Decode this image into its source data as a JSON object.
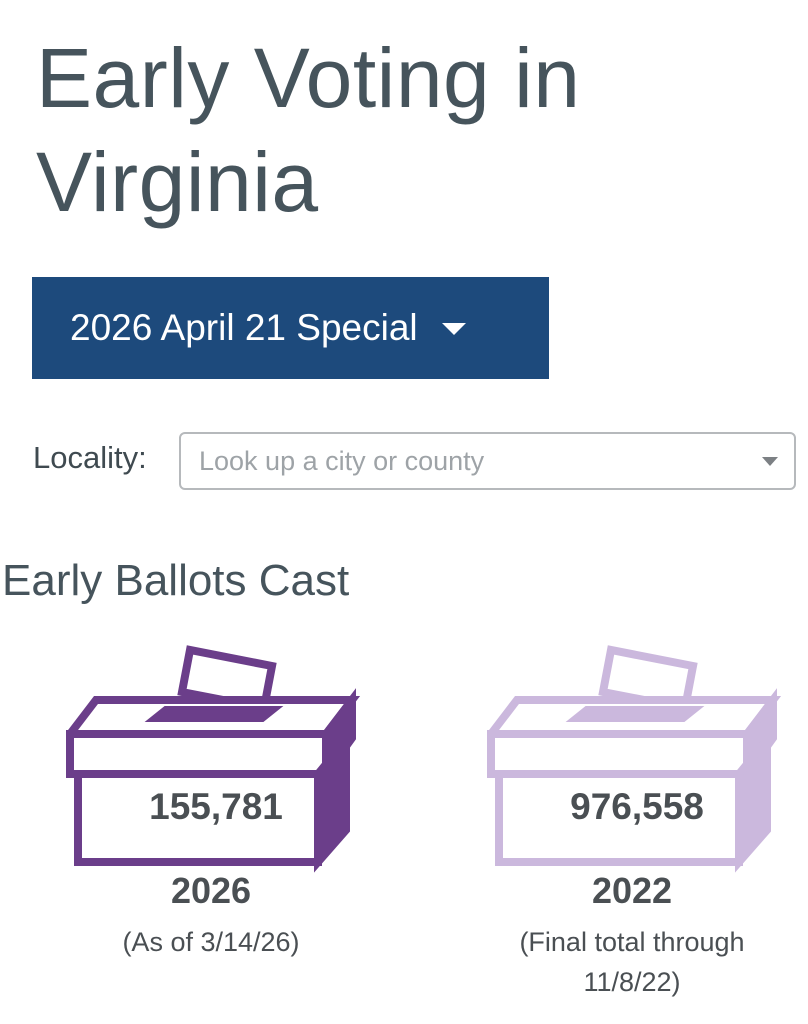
{
  "title": "Early Voting in Virginia",
  "election_select": {
    "label": "2026 April 21 Special"
  },
  "locality": {
    "label": "Locality:",
    "placeholder": "Look up a city or county"
  },
  "section_title": "Early Ballots Cast",
  "ballots": [
    {
      "count": "155,781",
      "year": "2026",
      "note": "(As of 3/14/26)",
      "color": "#6b3e8a",
      "icon": "ballot-box-icon"
    },
    {
      "count": "976,558",
      "year": "2022",
      "note": "(Final total through 11/8/22)",
      "color": "#cbb8dd",
      "icon": "ballot-box-icon"
    }
  ],
  "colors": {
    "select_bg": "#1d4a7c",
    "heading": "#46545c"
  }
}
